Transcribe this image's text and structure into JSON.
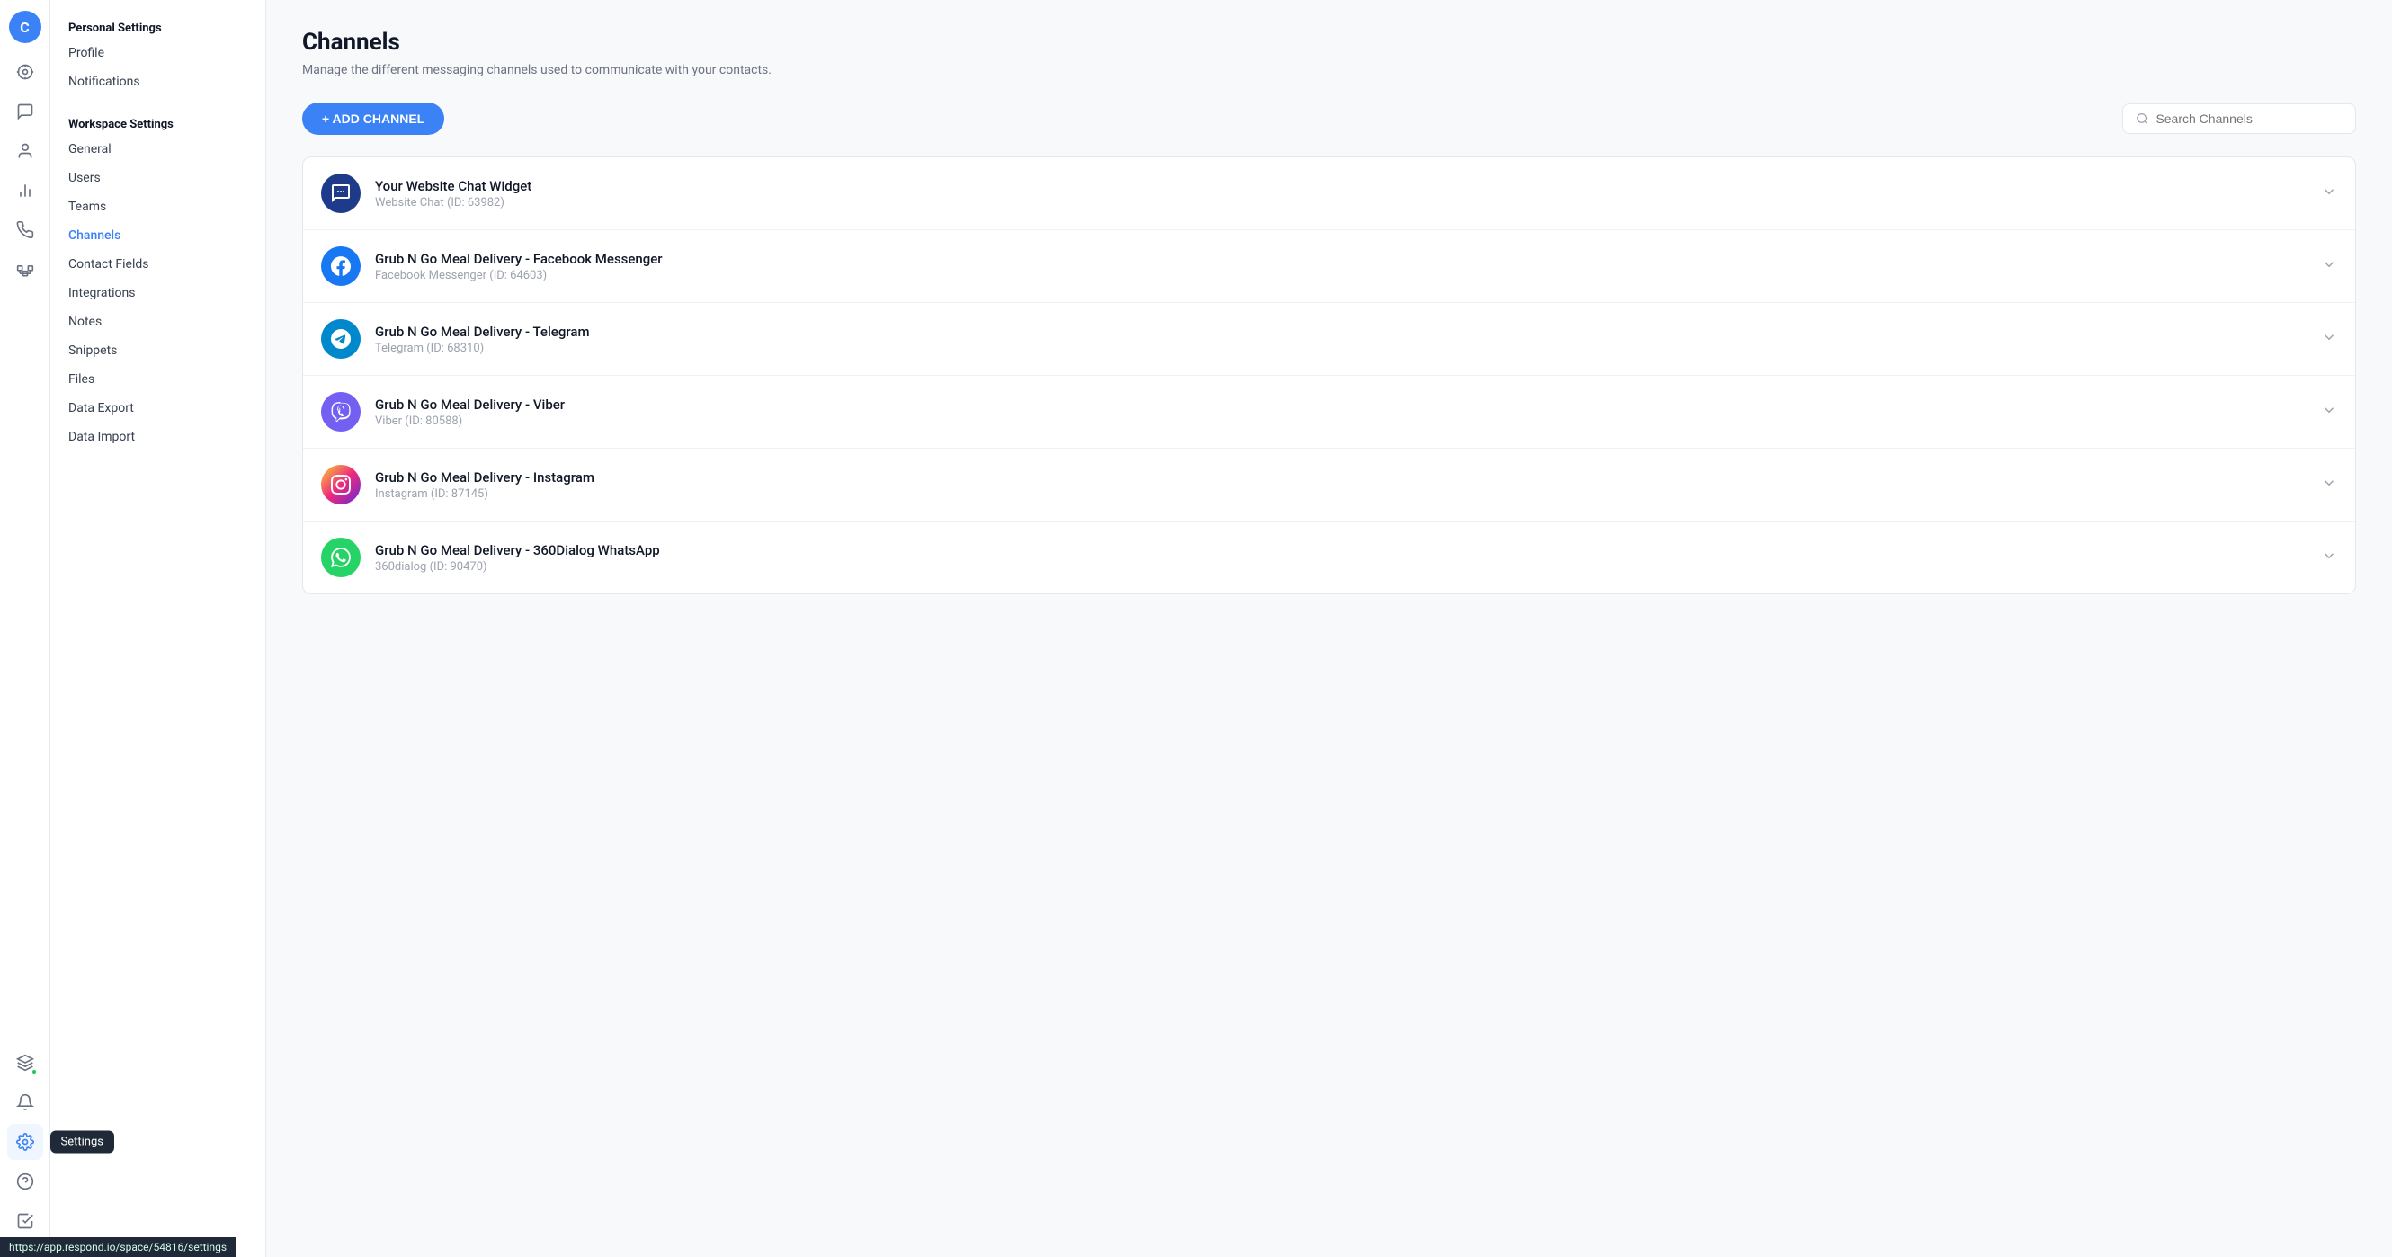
{
  "app": {
    "avatar_letter": "C",
    "url_bar": "https://app.respond.io/space/54816/settings"
  },
  "icon_nav": {
    "items": [
      {
        "name": "dashboard-icon",
        "label": "Dashboard",
        "active": false
      },
      {
        "name": "conversations-icon",
        "label": "Conversations",
        "active": false
      },
      {
        "name": "contacts-icon",
        "label": "Contacts",
        "active": false
      },
      {
        "name": "reports-icon",
        "label": "Reports",
        "active": false
      },
      {
        "name": "broadcasts-icon",
        "label": "Broadcasts",
        "active": false
      },
      {
        "name": "settings-icon",
        "label": "Settings",
        "active": true
      }
    ],
    "bottom_items": [
      {
        "name": "integrations-bottom-icon",
        "label": "Integrations",
        "active": false
      },
      {
        "name": "notifications-bottom-icon",
        "label": "Notifications",
        "active": false
      },
      {
        "name": "help-icon",
        "label": "Help",
        "active": false
      },
      {
        "name": "tasks-icon",
        "label": "Tasks",
        "active": false
      }
    ]
  },
  "sidebar": {
    "personal_settings_title": "Personal Settings",
    "profile_label": "Profile",
    "notifications_label": "Notifications",
    "workspace_settings_title": "Workspace Settings",
    "workspace_items": [
      {
        "label": "General",
        "active": false
      },
      {
        "label": "Users",
        "active": false
      },
      {
        "label": "Teams",
        "active": false
      },
      {
        "label": "Channels",
        "active": true
      },
      {
        "label": "Contact Fields",
        "active": false
      },
      {
        "label": "Integrations",
        "active": false
      },
      {
        "label": "Notes",
        "active": false
      },
      {
        "label": "Snippets",
        "active": false
      },
      {
        "label": "Files",
        "active": false
      },
      {
        "label": "Data Export",
        "active": false
      },
      {
        "label": "Data Import",
        "active": false
      }
    ]
  },
  "settings_tooltip": "Settings",
  "main": {
    "page_title": "Channels",
    "page_subtitle": "Manage the different messaging channels used to communicate with your contacts.",
    "add_channel_label": "+ ADD CHANNEL",
    "search_placeholder": "Search Channels",
    "channels": [
      {
        "name": "Your Website Chat Widget",
        "sub": "Website Chat (ID: 63982)",
        "icon_type": "webchat",
        "icon_symbol": "💬"
      },
      {
        "name": "Grub N Go Meal Delivery - Facebook Messenger",
        "sub": "Facebook Messenger (ID: 64603)",
        "icon_type": "facebook",
        "icon_symbol": "f"
      },
      {
        "name": "Grub N Go Meal Delivery - Telegram",
        "sub": "Telegram (ID: 68310)",
        "icon_type": "telegram",
        "icon_symbol": "✈"
      },
      {
        "name": "Grub N Go Meal Delivery - Viber",
        "sub": "Viber (ID: 80588)",
        "icon_type": "viber",
        "icon_symbol": "📞"
      },
      {
        "name": "Grub N Go Meal Delivery - Instagram",
        "sub": "Instagram (ID: 87145)",
        "icon_type": "instagram",
        "icon_symbol": "📷"
      },
      {
        "name": "Grub N Go Meal Delivery - 360Dialog WhatsApp",
        "sub": "360dialog (ID: 90470)",
        "icon_type": "whatsapp",
        "icon_symbol": "💬"
      }
    ]
  }
}
